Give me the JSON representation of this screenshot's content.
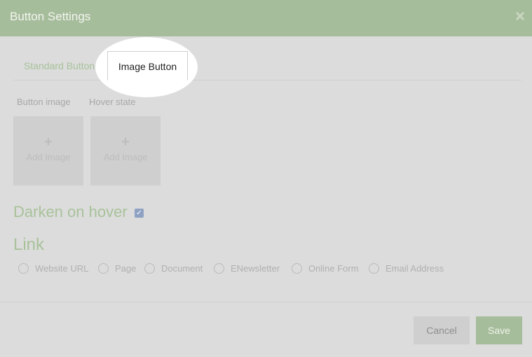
{
  "dialog": {
    "title": "Button Settings",
    "close_symbol": "×"
  },
  "tabs": {
    "standard": "Standard Button",
    "image": "Image Button"
  },
  "images": {
    "button_image_label": "Button image",
    "hover_state_label": "Hover state",
    "plus": "+",
    "add_label": "Add Image"
  },
  "darken": {
    "label": "Darken on hover",
    "checked": true,
    "check_mark": "✓"
  },
  "link": {
    "heading": "Link",
    "options": [
      "Website URL",
      "Page",
      "Document",
      "ENewsletter",
      "Online Form",
      "Email Address"
    ]
  },
  "footer": {
    "cancel": "Cancel",
    "save": "Save"
  },
  "colors": {
    "header": "#a6bd9b",
    "accent_text": "#a8c29a",
    "checkbox": "#8fa2c4"
  }
}
